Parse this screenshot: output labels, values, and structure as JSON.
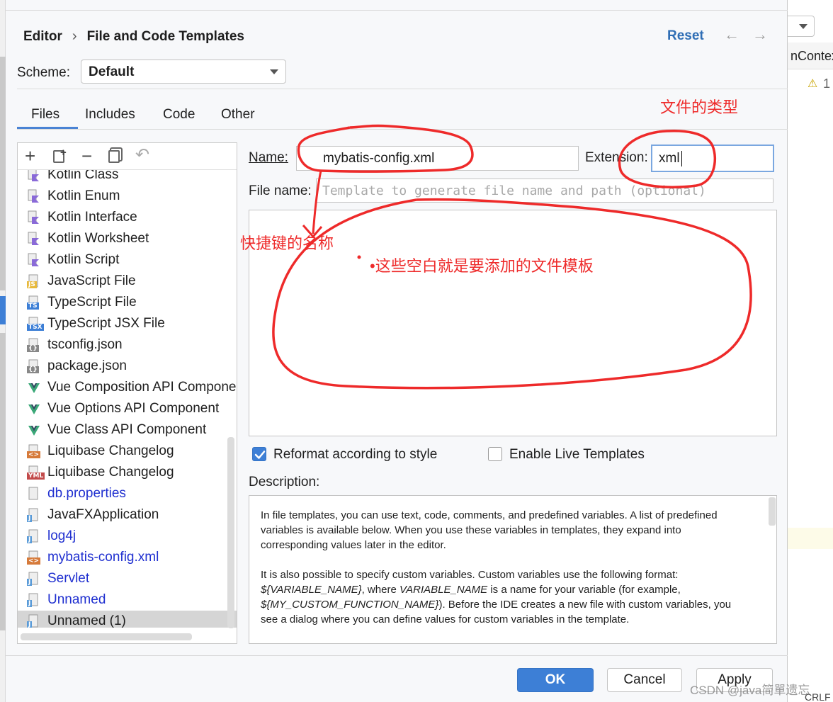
{
  "header": {
    "crumb_parent": "Editor",
    "crumb_separator": "›",
    "crumb_current": "File and Code Templates",
    "reset_label": "Reset",
    "back_arrow": "←",
    "forward_arrow": "→"
  },
  "scheme": {
    "label": "Scheme:",
    "value": "Default"
  },
  "tabs": [
    {
      "label": "Files",
      "active": true
    },
    {
      "label": "Includes"
    },
    {
      "label": "Code"
    },
    {
      "label": "Other"
    }
  ],
  "toolbar": {
    "add": "+",
    "remove": "−",
    "undo": "↶"
  },
  "templates": [
    {
      "label": "Kotlin Class",
      "icon": "kotlin-icon"
    },
    {
      "label": "Kotlin Enum",
      "icon": "kotlin-icon"
    },
    {
      "label": "Kotlin Interface",
      "icon": "kotlin-icon"
    },
    {
      "label": "Kotlin Worksheet",
      "icon": "kotlin-icon"
    },
    {
      "label": "Kotlin Script",
      "icon": "kotlin-icon"
    },
    {
      "label": "JavaScript File",
      "icon": "js-icon",
      "badge": "JS"
    },
    {
      "label": "TypeScript File",
      "icon": "ts-icon",
      "badge": "TS"
    },
    {
      "label": "TypeScript JSX File",
      "icon": "tsx-icon",
      "badge": "TSX"
    },
    {
      "label": "tsconfig.json",
      "icon": "json-icon",
      "badge": "{}"
    },
    {
      "label": "package.json",
      "icon": "json-icon",
      "badge": "{}"
    },
    {
      "label": "Vue Composition API Component",
      "icon": "vue-icon"
    },
    {
      "label": "Vue Options API Component",
      "icon": "vue-icon"
    },
    {
      "label": "Vue Class API Component",
      "icon": "vue-icon"
    },
    {
      "label": "Liquibase Changelog",
      "icon": "xml-icon",
      "badge": "<>"
    },
    {
      "label": "Liquibase Changelog",
      "icon": "yml-icon",
      "badge": "YML"
    },
    {
      "label": "db.properties",
      "icon": "properties-icon",
      "custom": true
    },
    {
      "label": "JavaFXApplication",
      "icon": "java-icon",
      "badge": "J"
    },
    {
      "label": "log4j",
      "icon": "java-icon",
      "badge": "J",
      "custom": true
    },
    {
      "label": "mybatis-config.xml",
      "icon": "xml-icon",
      "badge": "<>",
      "custom": true
    },
    {
      "label": "Servlet",
      "icon": "java-icon",
      "badge": "J",
      "custom": true
    },
    {
      "label": "Unnamed",
      "icon": "java-icon",
      "badge": "J",
      "custom": true
    },
    {
      "label": "Unnamed (1)",
      "icon": "java-icon",
      "badge": "J",
      "selected": true
    }
  ],
  "form": {
    "name_label": "Name:",
    "name_value": "mybatis-config.xml",
    "extension_label": "Extension:",
    "extension_value": "xml",
    "filename_label": "File name:",
    "filename_placeholder": "Template to generate file name and path (optional)",
    "body_value": ""
  },
  "options": {
    "reformat_label": "Reformat according to style",
    "reformat_checked": true,
    "live_label": "Enable Live Templates",
    "live_checked": false
  },
  "description": {
    "label": "Description:",
    "p1": "In file templates, you can use text, code, comments, and predefined variables. A list of predefined variables is available below. When you use these variables in templates, they expand into corresponding values later in the editor.",
    "p2_a": "It is also possible to specify custom variables. Custom variables use the following format: ",
    "p2_var1": "${VARIABLE_NAME}",
    "p2_b": ", where ",
    "p2_var2": "VARIABLE_NAME",
    "p2_c": " is a name for your variable (for example, ",
    "p2_var3": "${MY_CUSTOM_FUNCTION_NAME}",
    "p2_d": "). Before the IDE creates a new file with custom variables, you see a dialog where you can define values for custom variables in the template."
  },
  "buttons": {
    "ok": "OK",
    "cancel": "Cancel",
    "apply": "Apply"
  },
  "annotations": {
    "file_type": "文件的类型",
    "shortcut_name": "快捷键的名称",
    "blank_area": "•这些空白就是要添加的文件模板"
  },
  "background": {
    "context_text": "nContex",
    "warning_count": "1",
    "bottom_text": "CRLF",
    "watermark": "CSDN @java简單遗忘"
  },
  "colors": {
    "accent": "#3d7fd6",
    "custom_item": "#2030d0",
    "annotation": "#ee2a2a",
    "selected_row": "#d5d5d5"
  }
}
